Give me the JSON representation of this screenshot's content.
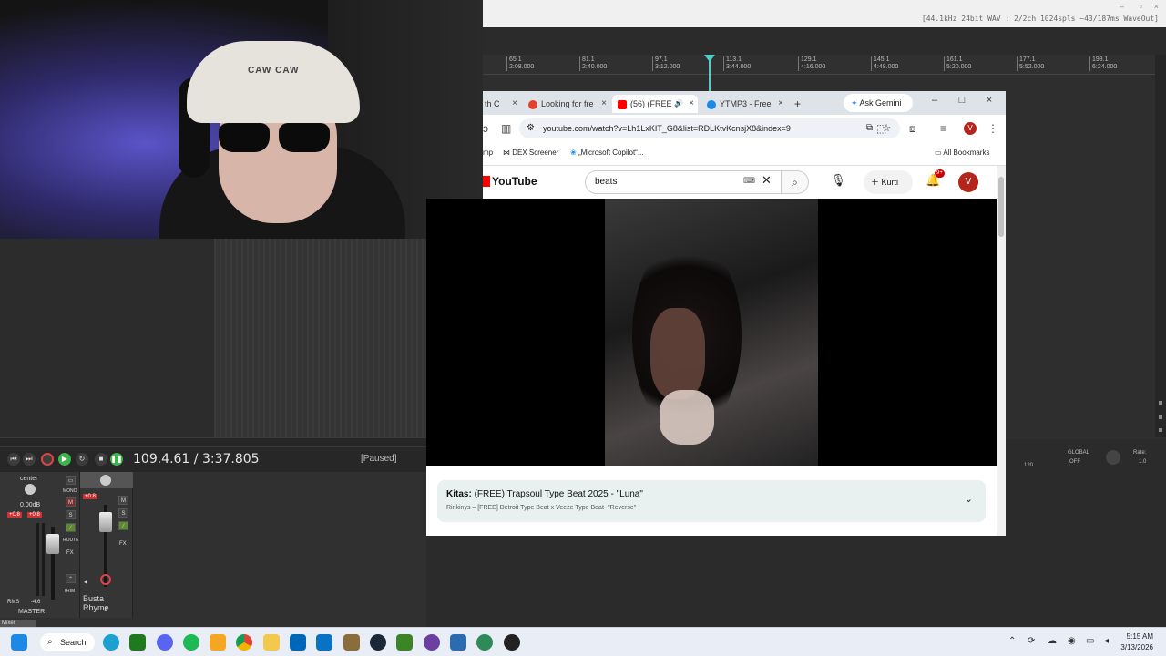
{
  "daw": {
    "format_info": "[44.1kHz 24bit WAV : 2/2ch 1024spls ~43/187ms WaveOut]",
    "ruler_ticks": [
      {
        "bar": "65.1",
        "time": "2:08.000"
      },
      {
        "bar": "81.1",
        "time": "2:40.000"
      },
      {
        "bar": "97.1",
        "time": "3:12.000"
      },
      {
        "bar": "113.1",
        "time": "3:44.000"
      },
      {
        "bar": "129.1",
        "time": "4:16.000"
      },
      {
        "bar": "145.1",
        "time": "4:48.000"
      },
      {
        "bar": "161.1",
        "time": "5:20.000"
      },
      {
        "bar": "177.1",
        "time": "5:52.000"
      },
      {
        "bar": "193.1",
        "time": "6:24.000"
      }
    ],
    "time_readout": "109.4.61 / 3:37.805",
    "status": "[Paused]",
    "master": {
      "pan_label": "center",
      "volume_label": "0.00dB",
      "peak_left": "+0.8",
      "peak_right": "+0.8",
      "rms_label": "RMS",
      "rms_value": "-4.6",
      "name": "MASTER",
      "mono_label": "MONO",
      "route_label": "ROUTE",
      "fx_label": "FX",
      "trim_label": "TRIM",
      "m_label": "M",
      "s_label": "S"
    },
    "track": {
      "peak": "+0.8",
      "name": "Busta Rhyme",
      "number": "1",
      "m_label": "M",
      "s_label": "S",
      "fx_label": "FX"
    },
    "mixer_tab": "Mixer",
    "right_panel": {
      "bpm": "120",
      "global_label": "GLOBAL",
      "global_value": "OFF",
      "rate_label": "Rate:",
      "rate_value": "1.0"
    }
  },
  "webcam": {
    "hat_text": "CAW CAW"
  },
  "browser": {
    "tabs": [
      {
        "label": "th C"
      },
      {
        "label": "Looking for fre"
      },
      {
        "label": "(56) (FREE"
      },
      {
        "label": "YTMP3 - Free"
      }
    ],
    "new_tab": "+",
    "gemini_label": "Ask Gemini",
    "url": "youtube.com/watch?v=Lh1LxKIT_G8&list=RDLKtvKcnsjX8&index=9",
    "profile_initial": "V",
    "bookmarks": [
      {
        "label": "mp"
      },
      {
        "label": "DEX Screener"
      },
      {
        "label": "„Microsoft Copilot“..."
      }
    ],
    "all_bookmarks": "All Bookmarks"
  },
  "youtube": {
    "logo": "YouTube",
    "search_value": "beats",
    "create_label": "Kurti",
    "notif_count": "9+",
    "avatar_initial": "V",
    "playlist": {
      "owner": "Kitas:",
      "title": " (FREE) Trapsoul Type Beat 2025 - \"Luna\"",
      "subtitle": "Rinkinys – [FREE] Detroit Type Beat x Veeze Type Beat- \"Reverse\""
    }
  },
  "taskbar": {
    "search_label": "Search",
    "time": "5:15 AM",
    "date": "3/13/2026"
  },
  "icons": {
    "windows": "windows-icon",
    "edge": "edge-icon",
    "chrome": "chrome-icon",
    "spotify": "spotify-icon"
  },
  "colors": {
    "playhead": "#4dd0c8",
    "yt_red": "#ff0000",
    "avatar": "#b4261c",
    "playlist_bg": "#e8f1ef"
  }
}
